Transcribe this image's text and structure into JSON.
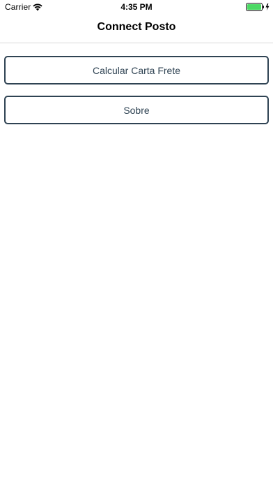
{
  "status_bar": {
    "carrier": "Carrier",
    "time": "4:35 PM",
    "battery_color": "#4cd964"
  },
  "nav": {
    "title": "Connect Posto"
  },
  "menu": {
    "items": [
      {
        "label": "Calcular Carta Frete"
      },
      {
        "label": "Sobre"
      }
    ]
  },
  "colors": {
    "button_border": "#2f4353",
    "button_text": "#2f4353"
  }
}
